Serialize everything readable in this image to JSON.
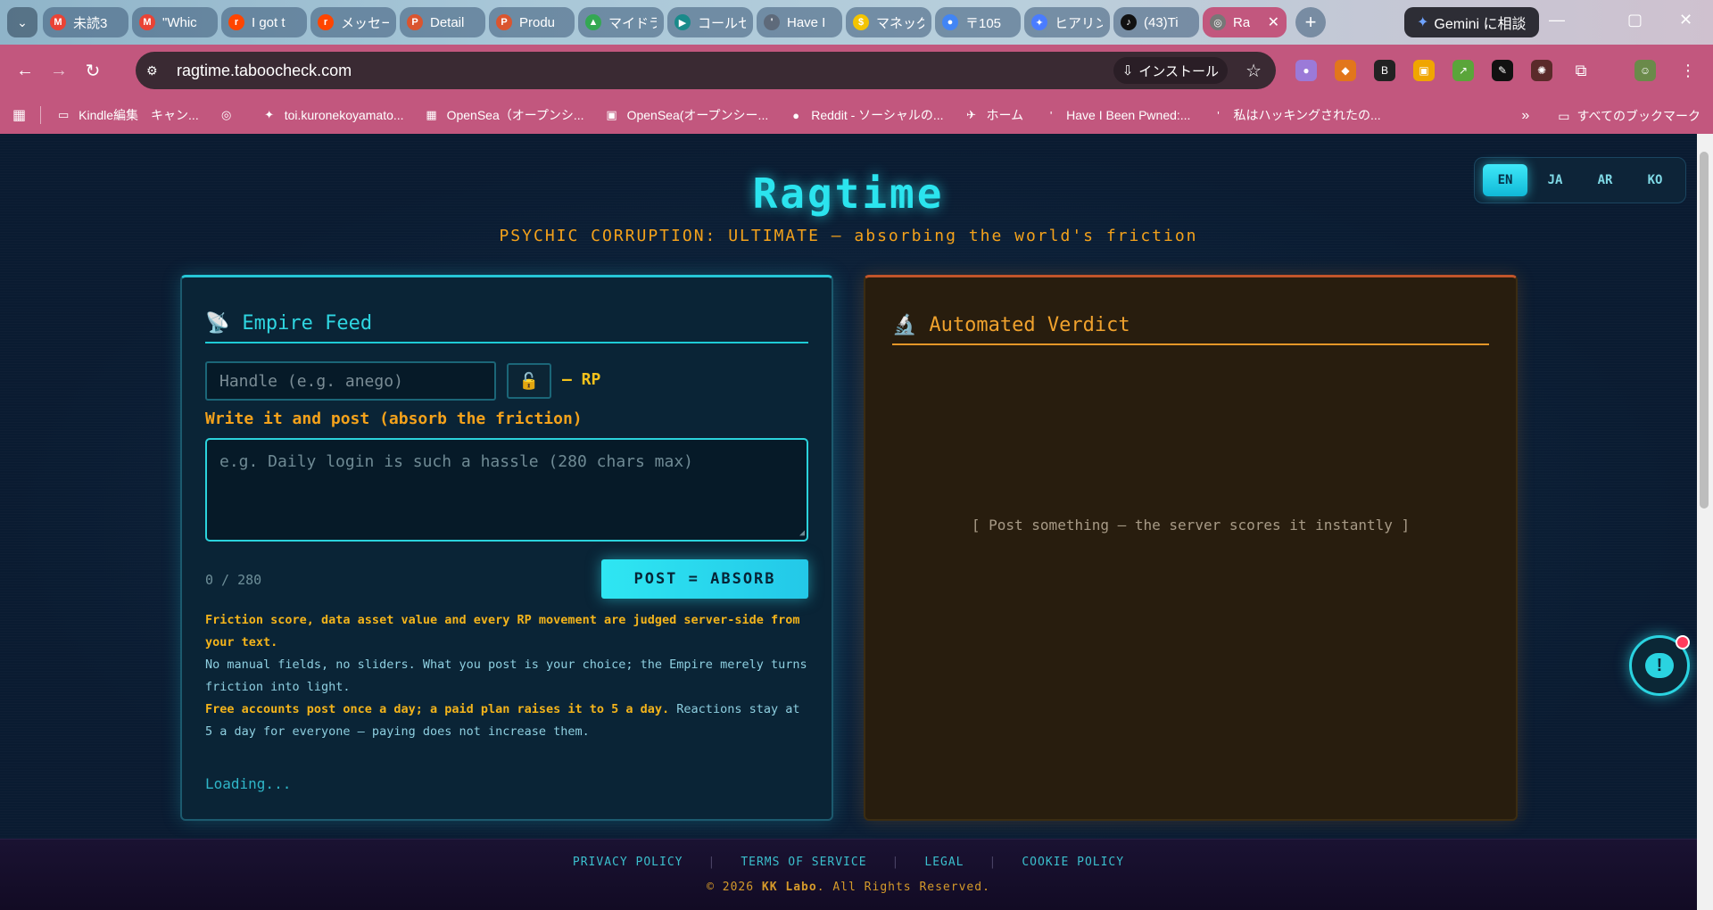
{
  "browser": {
    "tabs": [
      {
        "label": "未読3",
        "icon": "gmail-icon",
        "color": "#ea4335",
        "glyph": "M"
      },
      {
        "label": "\"Whic",
        "icon": "gmail-icon",
        "color": "#ea4335",
        "glyph": "M"
      },
      {
        "label": "I got t",
        "icon": "reddit-icon",
        "color": "#ff4500",
        "glyph": "r"
      },
      {
        "label": "メッセー",
        "icon": "reddit-icon",
        "color": "#ff4500",
        "glyph": "r"
      },
      {
        "label": "Detail",
        "icon": "producthunt-icon",
        "color": "#da552f",
        "glyph": "P"
      },
      {
        "label": "Produ",
        "icon": "producthunt-icon",
        "color": "#da552f",
        "glyph": "P"
      },
      {
        "label": "マイドラ",
        "icon": "drive-icon",
        "color": "#34a853",
        "glyph": "▲"
      },
      {
        "label": "コールセ",
        "icon": "play-icon",
        "color": "#1a8a8a",
        "glyph": "▶"
      },
      {
        "label": "Have I",
        "icon": "hibp-icon",
        "color": "#5e6a7a",
        "glyph": "'"
      },
      {
        "label": "マネッグ",
        "icon": "money-icon",
        "color": "#f4c400",
        "glyph": "$"
      },
      {
        "label": "〒105",
        "icon": "maps-icon",
        "color": "#4285f4",
        "glyph": "●"
      },
      {
        "label": "ヒアリン",
        "icon": "gemini-tab-icon",
        "color": "#4a7cff",
        "glyph": "✦"
      },
      {
        "label": "(43)Ti",
        "icon": "tiktok-icon",
        "color": "#111111",
        "glyph": "♪"
      },
      {
        "label": "Ra",
        "icon": "globe-icon",
        "color": "#777777",
        "glyph": "◎"
      }
    ],
    "gemini_label": "Gemini に相談",
    "url": "ragtime.taboocheck.com",
    "install_label": "インストール",
    "bookmarks": [
      {
        "label": "Kindle編集　キャン...",
        "icon": "folder-icon"
      },
      {
        "label": "",
        "icon": "globe-icon"
      },
      {
        "label": "toi.kuronekoyamato...",
        "icon": "yamato-icon"
      },
      {
        "label": "OpenSea（オープンシ...",
        "icon": "opensea-icon"
      },
      {
        "label": "OpenSea(オープンシー...",
        "icon": "opensea-doc-icon"
      },
      {
        "label": "Reddit - ソーシャルの...",
        "icon": "reddit-icon"
      },
      {
        "label": "ホーム",
        "icon": "bluesky-icon"
      },
      {
        "label": "Have I Been Pwned:...",
        "icon": "hibp-icon"
      },
      {
        "label": "私はハッキングされたの...",
        "icon": "hibp-icon"
      }
    ],
    "all_bookmarks_label": "すべてのブックマーク"
  },
  "site": {
    "title": "Ragtime",
    "subtitle": "PSYCHIC CORRUPTION: ULTIMATE — absorbing the world's friction",
    "languages": [
      {
        "code": "EN",
        "active": true
      },
      {
        "code": "JA",
        "active": false
      },
      {
        "code": "AR",
        "active": false
      },
      {
        "code": "KO",
        "active": false
      }
    ]
  },
  "feed": {
    "heading": "Empire Feed",
    "heading_icon": "satellite-dish-icon",
    "handle_placeholder": "Handle (e.g. anego)",
    "rp_label": "— RP",
    "write_label": "Write it and post (absorb the friction)",
    "post_placeholder": "e.g. Daily login is such a hassle (280 chars max)",
    "counter": "0 / 280",
    "post_button": "POST = ABSORB",
    "info_1": "Friction score, data asset value and every RP movement are judged server-side from your text.",
    "info_2": "No manual fields, no sliders. What you post is your choice; the Empire merely turns friction into light.",
    "info_3a": "Free accounts post once a day; a paid plan raises it to 5 a day.",
    "info_3b": " Reactions stay at 5 a day for everyone — paying does not increase them.",
    "loading": "Loading..."
  },
  "verdict": {
    "heading": "Automated Verdict",
    "heading_icon": "microscope-icon",
    "empty_text": "[ Post something — the server scores it instantly ]"
  },
  "footer": {
    "links": [
      "PRIVACY POLICY",
      "TERMS OF SERVICE",
      "LEGAL",
      "COOKIE POLICY"
    ],
    "copyright_prefix": "© 2026 ",
    "copyright_brand": "KK Labo",
    "copyright_suffix": ". All Rights Reserved."
  },
  "colors": {
    "accent_cyan": "#2be4ee",
    "accent_orange": "#f4a21b",
    "chrome_pink": "#c2577e"
  }
}
